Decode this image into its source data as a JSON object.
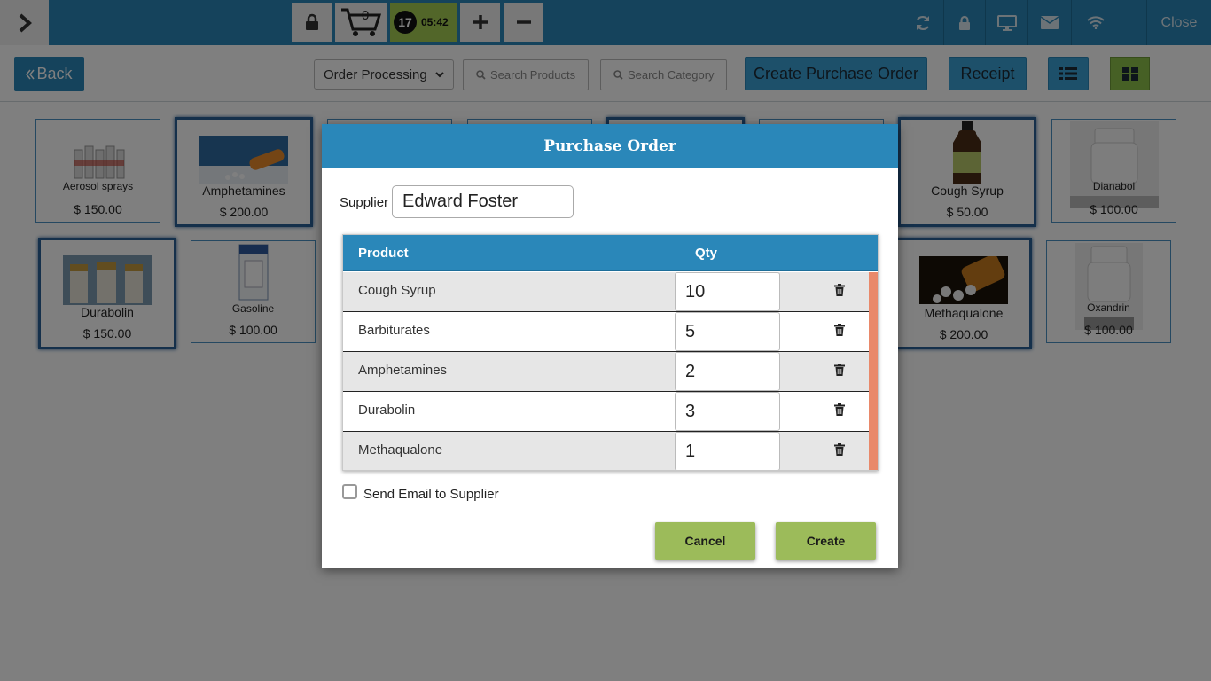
{
  "topbar": {
    "cart_count": "0",
    "timer_badge": "17",
    "timer_time": "05:42",
    "close_label": "Close"
  },
  "subbar": {
    "back_label": "Back",
    "order_select_value": "Order Processing",
    "search_products_placeholder": "Search Products",
    "search_category_placeholder": "Search Category",
    "create_po_label": "Create Purchase Order",
    "receipt_label": "Receipt"
  },
  "products": [
    {
      "name": "Aerosol sprays",
      "price": "$ 150.00"
    },
    {
      "name": "Amphetamines",
      "price": "$ 200.00"
    },
    {
      "name": "Cough Syrup",
      "price": "$ 50.00"
    },
    {
      "name": "Dianabol",
      "price": "$ 100.00"
    },
    {
      "name": "Durabolin",
      "price": "$ 150.00"
    },
    {
      "name": "Gasoline",
      "price": "$ 100.00"
    },
    {
      "name": "Methaqualone",
      "price": "$ 200.00"
    },
    {
      "name": "Oxandrin",
      "price": "$ 100.00"
    }
  ],
  "modal": {
    "title": "Purchase Order",
    "supplier_label": "Supplier",
    "supplier_value": "Edward Foster",
    "table_headers": {
      "product": "Product",
      "qty": "Qty"
    },
    "rows": [
      {
        "product": "Cough Syrup",
        "qty": "10"
      },
      {
        "product": "Barbiturates",
        "qty": "5"
      },
      {
        "product": "Amphetamines",
        "qty": "2"
      },
      {
        "product": "Durabolin",
        "qty": "3"
      },
      {
        "product": "Methaqualone",
        "qty": "1"
      }
    ],
    "email_label": "Send Email to Supplier",
    "cancel_label": "Cancel",
    "create_label": "Create"
  },
  "colors": {
    "primary": "#2a87b9",
    "accent_green": "#9cbb5a",
    "scroll_orange": "#e9896a"
  },
  "icons": [
    "chevron-right-icon",
    "lock-icon",
    "cart-icon",
    "plus-icon",
    "minus-icon",
    "refresh-icon",
    "monitor-icon",
    "mail-icon",
    "wifi-icon",
    "search-icon",
    "list-icon",
    "grid-icon",
    "trash-icon"
  ]
}
